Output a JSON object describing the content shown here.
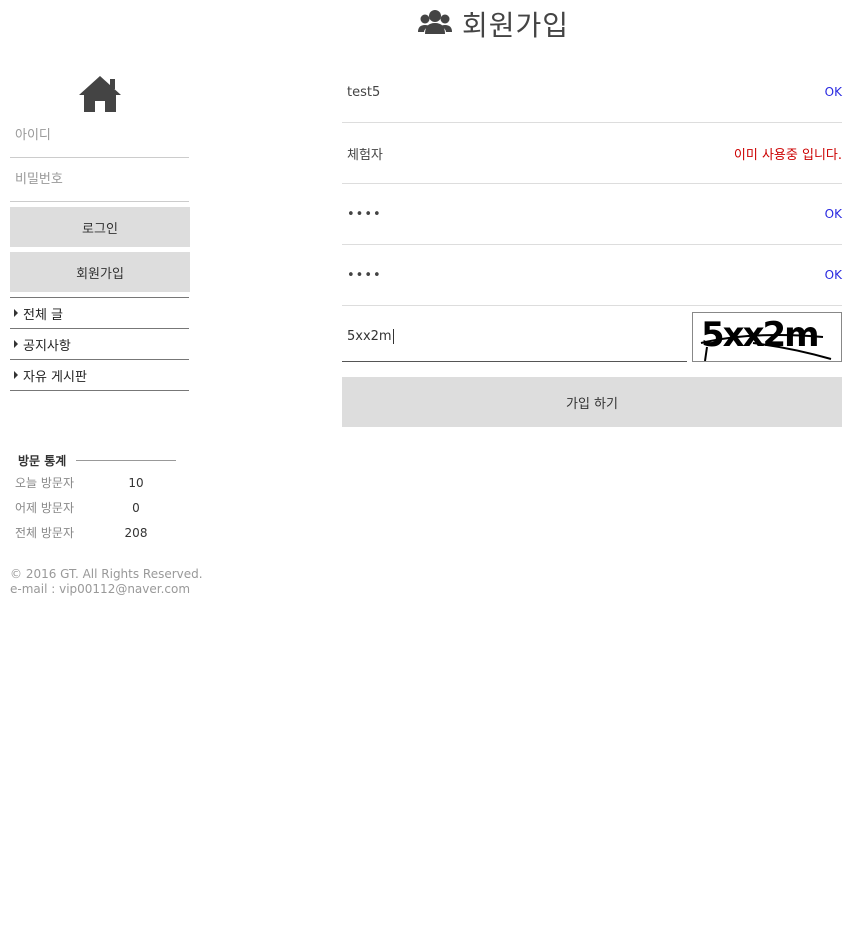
{
  "header": {
    "title": "회원가입",
    "icon": "users-icon"
  },
  "sidebar": {
    "home_icon": "home-icon",
    "id_placeholder": "아이디",
    "password_placeholder": "비밀번호",
    "login_label": "로그인",
    "signup_label": "회원가입",
    "menu": [
      {
        "label": "전체 글"
      },
      {
        "label": "공지사항"
      },
      {
        "label": "자유 게시판"
      }
    ]
  },
  "stats": {
    "title": "방문 통계",
    "rows": [
      {
        "label": "오늘 방문자",
        "value": "10"
      },
      {
        "label": "어제 방문자",
        "value": "0"
      },
      {
        "label": "전체 방문자",
        "value": "208"
      }
    ]
  },
  "footer": {
    "copyright": "© 2016 GT. All Rights Reserved.",
    "email": "e-mail : vip00112@naver.com"
  },
  "form": {
    "username": {
      "value": "test5",
      "status": "OK"
    },
    "nickname": {
      "value": "체험자",
      "status": "이미 사용중 입니다."
    },
    "password": {
      "value": "••••",
      "status": "OK"
    },
    "password_confirm": {
      "value": "••••",
      "status": "OK"
    },
    "captcha": {
      "value": "5xx2m",
      "image_text": "5xx2m"
    },
    "submit_label": "가입 하기"
  },
  "colors": {
    "ok": "#2a2ae0",
    "error": "#cc0000",
    "button_bg": "#dddddd"
  }
}
